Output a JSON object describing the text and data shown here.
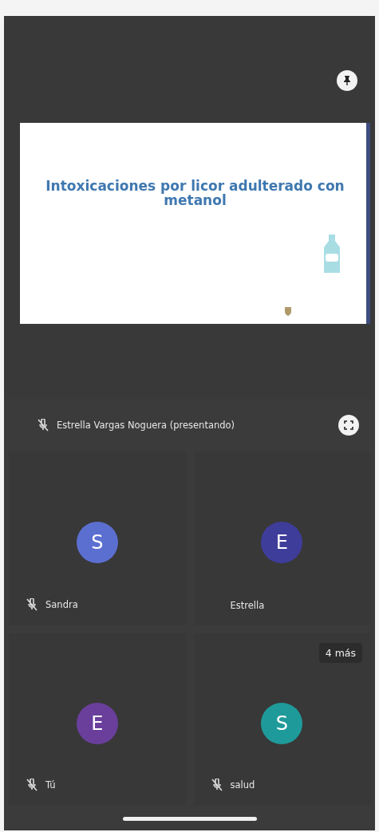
{
  "presentation": {
    "slide_title": "Intoxicaciones por licor adulterado con metanol",
    "pinned": true
  },
  "presenter": {
    "label": "Estrella Vargas Noguera (presentando)",
    "muted": true
  },
  "participants": [
    {
      "initial": "S",
      "name": "Sandra",
      "color": "#5b6fd0",
      "muted": true
    },
    {
      "initial": "E",
      "name": "Estrella",
      "color": "#3f3d9a",
      "muted": false
    },
    {
      "initial": "E",
      "name": "Tú",
      "color": "#6a3f9c",
      "muted": true
    },
    {
      "initial": "S",
      "name": "salud",
      "color": "#1f9a9a",
      "muted": true
    }
  ],
  "more_badge": "4 más"
}
